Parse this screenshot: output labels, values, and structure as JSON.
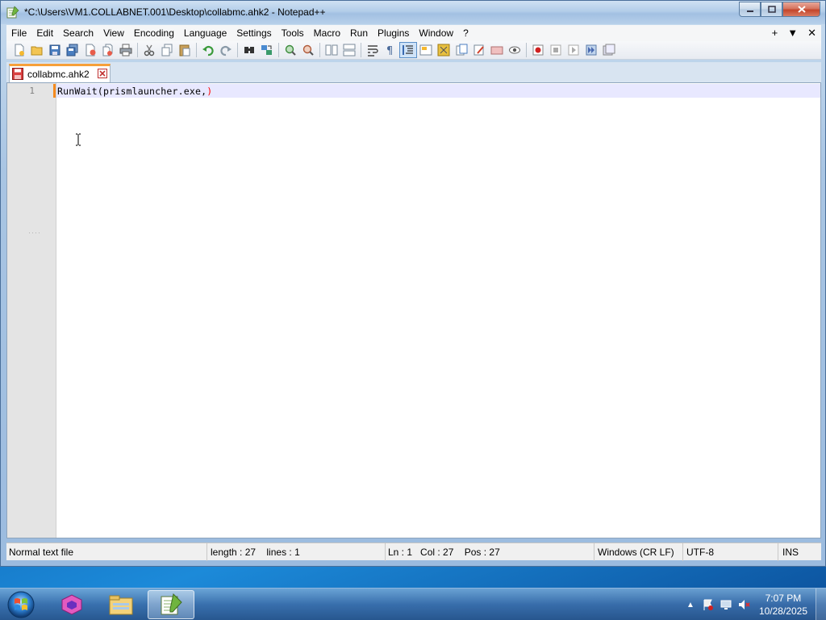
{
  "window": {
    "title": "*C:\\Users\\VM1.COLLABNET.001\\Desktop\\collabmc.ahk2 - Notepad++",
    "controls": {
      "minimize": "—",
      "maximize": "□",
      "close": "✕"
    }
  },
  "menu": {
    "items": [
      "File",
      "Edit",
      "Search",
      "View",
      "Encoding",
      "Language",
      "Settings",
      "Tools",
      "Macro",
      "Run",
      "Plugins",
      "Window",
      "?"
    ],
    "right": {
      "add": "+",
      "dropdown": "▼",
      "close": "✕"
    }
  },
  "toolbar": {
    "icons": [
      "new-file-icon",
      "open-file-icon",
      "save-icon",
      "save-all-icon",
      "close-icon",
      "close-all-icon",
      "print-icon",
      "cut-icon",
      "copy-icon",
      "paste-icon",
      "undo-icon",
      "redo-icon",
      "find-icon",
      "replace-icon",
      "zoom-in-icon",
      "zoom-out-icon",
      "sync-vertical-icon",
      "sync-horizontal-icon",
      "word-wrap-icon",
      "show-all-characters-icon",
      "indent-guide-icon",
      "udl-icon",
      "document-map-icon",
      "function-list-icon",
      "folder-as-workspace-icon",
      "document-list-icon",
      "monitoring-icon",
      "record-macro-icon",
      "stop-recording-icon",
      "playback-icon",
      "run-macro-multiple-icon",
      "save-macro-icon"
    ]
  },
  "tabs": [
    {
      "label": "collabmc.ahk2",
      "modified": true,
      "active": true
    }
  ],
  "editor": {
    "line_number": "1",
    "code": "RunWait(prismlauncher.exe,)"
  },
  "status": {
    "file_type": "Normal text file",
    "length": "length : 27",
    "lines": "lines : 1",
    "ln": "Ln : 1",
    "col": "Col : 27",
    "pos": "Pos : 27",
    "eol": "Windows (CR LF)",
    "encoding": "UTF-8",
    "mode": "INS"
  },
  "taskbar": {
    "items": [
      "start-button",
      "app-icon-pink",
      "explorer-icon",
      "notepad-plus-plus-icon"
    ],
    "clock_time": "7:07 PM",
    "clock_date": "10/28/2025"
  },
  "colors": {
    "accent": "#f6a03a",
    "current_line": "#e8e8ff",
    "brace_highlight": "#ff0000"
  }
}
